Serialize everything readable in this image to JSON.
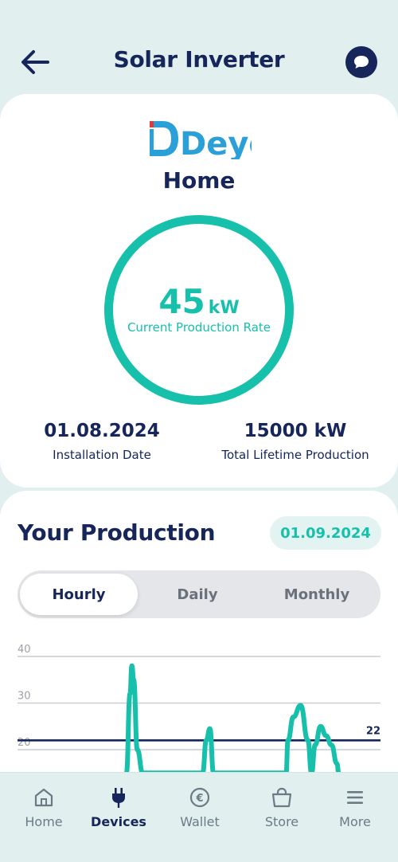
{
  "header": {
    "title": "Solar Inverter",
    "back_icon": "arrow-left-icon",
    "chat_icon": "chat-bubble-icon"
  },
  "inverter": {
    "brand": "Deye",
    "site_name": "Home",
    "current_rate_value": "45",
    "current_rate_unit": "kW",
    "current_rate_label": "Current Production Rate",
    "installation_date": "01.08.2024",
    "installation_date_label": "Installation Date",
    "lifetime_production": "15000 kW",
    "lifetime_production_label": "Total Lifetime Production"
  },
  "production": {
    "title": "Your Production",
    "date": "01.09.2024",
    "tabs": [
      {
        "label": "Hourly",
        "active": true
      },
      {
        "label": "Daily",
        "active": false
      },
      {
        "label": "Monthly",
        "active": false
      }
    ]
  },
  "chart_data": {
    "type": "line",
    "ylim": [
      15,
      40
    ],
    "yticks": [
      40,
      30,
      20
    ],
    "reference_line": {
      "value": 22,
      "label": "22",
      "color": "#16255a"
    },
    "series": [
      {
        "color": "#16c0ab",
        "points": [
          [
            0.3,
            15
          ],
          [
            0.31,
            32
          ],
          [
            0.315,
            38
          ],
          [
            0.32,
            35
          ],
          [
            0.33,
            20
          ],
          [
            0.345,
            15
          ],
          [
            0.51,
            15
          ],
          [
            0.52,
            22
          ],
          [
            0.53,
            24.5
          ],
          [
            0.54,
            15
          ],
          [
            0.74,
            15
          ],
          [
            0.745,
            22
          ],
          [
            0.76,
            27
          ],
          [
            0.78,
            29.5
          ],
          [
            0.8,
            22
          ],
          [
            0.81,
            15
          ],
          [
            0.82,
            21
          ],
          [
            0.835,
            25
          ],
          [
            0.85,
            23
          ],
          [
            0.865,
            21
          ],
          [
            0.88,
            17
          ],
          [
            0.885,
            15
          ]
        ]
      }
    ]
  },
  "nav": {
    "items": [
      {
        "label": "Home",
        "icon": "house-icon",
        "active": false
      },
      {
        "label": "Devices",
        "icon": "plug-icon",
        "active": true
      },
      {
        "label": "Wallet",
        "icon": "euro-coin-icon",
        "active": false
      },
      {
        "label": "Store",
        "icon": "shopping-bag-icon",
        "active": false
      },
      {
        "label": "More",
        "icon": "menu-icon",
        "active": false
      }
    ]
  },
  "colors": {
    "navy": "#16255a",
    "teal": "#16c0ab",
    "background": "#e1efef",
    "logo_red": "#e03a3a",
    "logo_blue": "#2a9fd8"
  }
}
